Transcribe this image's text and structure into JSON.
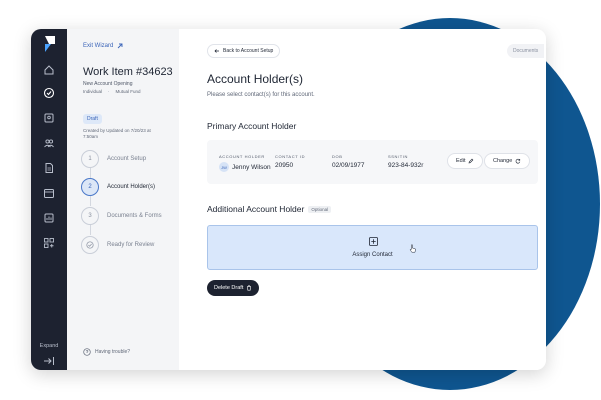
{
  "wizard": {
    "exit_label": "Exit Wizard",
    "work_item": "Work Item #34623",
    "subtitle": "New Account Opening",
    "tags": [
      "Individual",
      "Mutual Fund"
    ],
    "status": "Draft",
    "created": "Created by Updated on 7/20/23 at 7:50am",
    "steps": [
      {
        "number": "1",
        "label": "Account Setup"
      },
      {
        "number": "2",
        "label": "Account Holder(s)"
      },
      {
        "number": "3",
        "label": "Documents & Forms"
      },
      {
        "number": "",
        "label": "Ready for Review"
      }
    ],
    "help": "Having trouble?"
  },
  "rail": {
    "expand_label": "Expand"
  },
  "main": {
    "back_label": "Back to Account Setup",
    "documents_label": "Documents",
    "title": "Account Holder(s)",
    "subtitle": "Please select contact(s) for this account.",
    "primary_title": "Primary Account Holder",
    "primary": {
      "headers": {
        "holder": "Account Holder",
        "contact_id": "Contact ID",
        "dob": "DOB",
        "ssn": "SSN/TIN"
      },
      "initials": "JW",
      "name": "Jenny Wilson",
      "contact_id": "20950",
      "dob": "02/09/1977",
      "ssn": "923-84-932r",
      "edit_label": "Edit",
      "change_label": "Change"
    },
    "additional_title": "Additional Account Holder",
    "optional_label": "Optional",
    "assign_label": "Assign Contact",
    "delete_label": "Delete Draft"
  },
  "colors": {
    "rail": "#1d2230",
    "accent": "#3a64b8",
    "assign_bg": "#d9e7fb",
    "blob": "#0f5690"
  }
}
